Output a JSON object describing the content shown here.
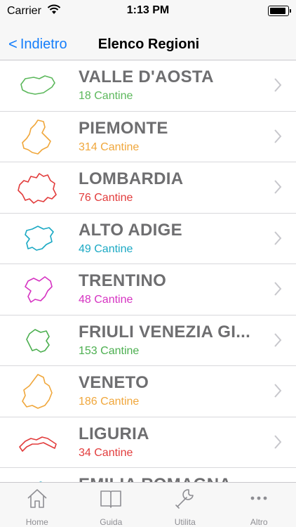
{
  "status_bar": {
    "carrier": "Carrier",
    "time": "1:13 PM"
  },
  "nav": {
    "back_label": "Indietro",
    "title": "Elenco Regioni"
  },
  "regions": [
    {
      "name": "VALLE D'AOSTA",
      "count": "18 Cantine",
      "color": "#5cb85c"
    },
    {
      "name": "PIEMONTE",
      "count": "314 Cantine",
      "color": "#f0a73c"
    },
    {
      "name": "LOMBARDIA",
      "count": "76 Cantine",
      "color": "#e23c3c"
    },
    {
      "name": "ALTO ADIGE",
      "count": "49 Cantine",
      "color": "#1ba9c4"
    },
    {
      "name": "TRENTINO",
      "count": "48 Cantine",
      "color": "#d633c2"
    },
    {
      "name": "FRIULI VENEZIA GI...",
      "count": "153 Cantine",
      "color": "#4caf50"
    },
    {
      "name": "VENETO",
      "count": "186 Cantine",
      "color": "#f0a73c"
    },
    {
      "name": "LIGURIA",
      "count": "34 Cantine",
      "color": "#e23c3c"
    },
    {
      "name": "EMILIA ROMAGNA",
      "count": "",
      "color": "#1ba9c4"
    }
  ],
  "tabs": [
    {
      "label": "Home",
      "icon": "home-icon"
    },
    {
      "label": "Guida",
      "icon": "book-icon"
    },
    {
      "label": "Utilita",
      "icon": "wrench-icon"
    },
    {
      "label": "Altro",
      "icon": "more-icon"
    }
  ]
}
